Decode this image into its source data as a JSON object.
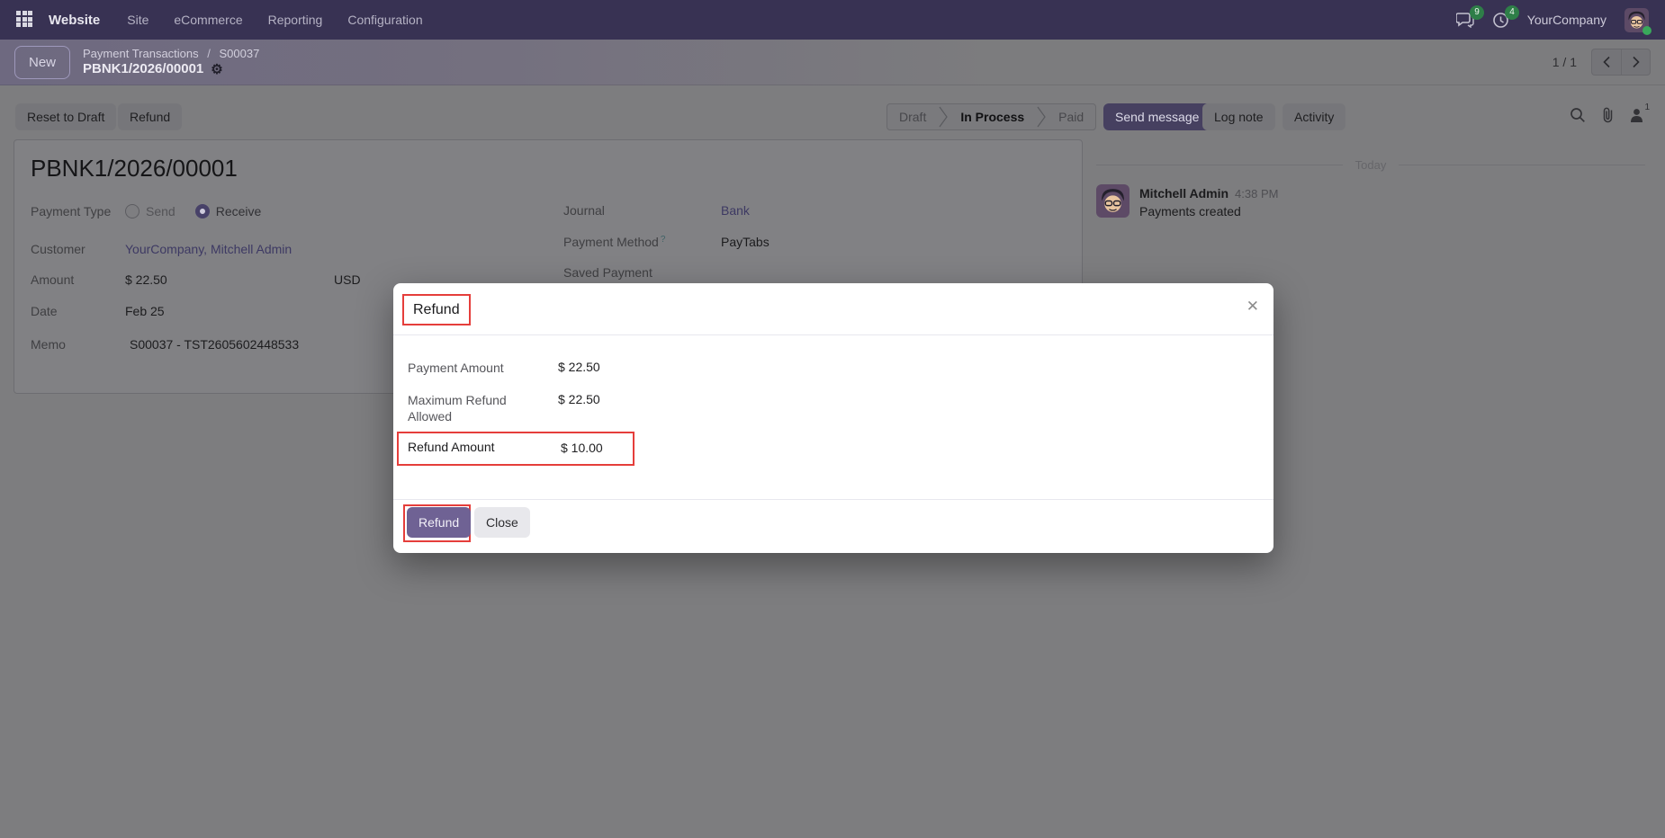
{
  "nav": {
    "app_name": "Website",
    "items": [
      "Site",
      "eCommerce",
      "Reporting",
      "Configuration"
    ],
    "badges": {
      "messages": "9",
      "activities": "4"
    },
    "company": "YourCompany"
  },
  "breadcrumb": {
    "new_label": "New",
    "root": "Payment Transactions",
    "separator": "/",
    "parent": "S00037",
    "current": "PBNK1/2026/00001"
  },
  "pager": {
    "label": "1 / 1"
  },
  "actions": {
    "reset_to_draft": "Reset to Draft",
    "refund": "Refund"
  },
  "statusbar": {
    "steps": [
      "Draft",
      "In Process",
      "Paid"
    ],
    "active": "In Process"
  },
  "chatter": {
    "send_message": "Send message",
    "log_note": "Log note",
    "activity": "Activity",
    "follower_count": "1",
    "date_divider": "Today",
    "message": {
      "author": "Mitchell Admin",
      "time": "4:38 PM",
      "body": "Payments created"
    }
  },
  "form": {
    "title": "PBNK1/2026/00001",
    "payment_type": {
      "label": "Payment Type",
      "options": {
        "send": "Send",
        "receive": "Receive"
      },
      "selected": "Receive"
    },
    "customer": {
      "label": "Customer",
      "value": "YourCompany, Mitchell Admin"
    },
    "amount": {
      "label": "Amount",
      "value": "$ 22.50",
      "currency": "USD"
    },
    "date": {
      "label": "Date",
      "value": "Feb 25"
    },
    "memo": {
      "label": "Memo",
      "value": "S00037 - TST2605602448533"
    },
    "journal": {
      "label": "Journal",
      "value": "Bank"
    },
    "payment_method": {
      "label": "Payment Method",
      "help": "?",
      "value": "PayTabs"
    },
    "saved_payment": {
      "label": "Saved Payment"
    }
  },
  "modal": {
    "title": "Refund",
    "close_glyph": "✕",
    "rows": {
      "payment_amount": {
        "label": "Payment Amount",
        "value": "$ 22.50"
      },
      "maximum_refund": {
        "label": "Maximum Refund Allowed",
        "value": "$ 22.50"
      },
      "refund_amount": {
        "label": "Refund Amount",
        "value": "$ 10.00"
      }
    },
    "footer": {
      "refund": "Refund",
      "close": "Close"
    }
  },
  "colors": {
    "navbar_bg": "#383253",
    "accent_button": "#6f6294",
    "annotation_red": "#e53e3b",
    "link": "#3d3963",
    "badge_green": "#2e7e48",
    "status_green": "#39a85b"
  }
}
